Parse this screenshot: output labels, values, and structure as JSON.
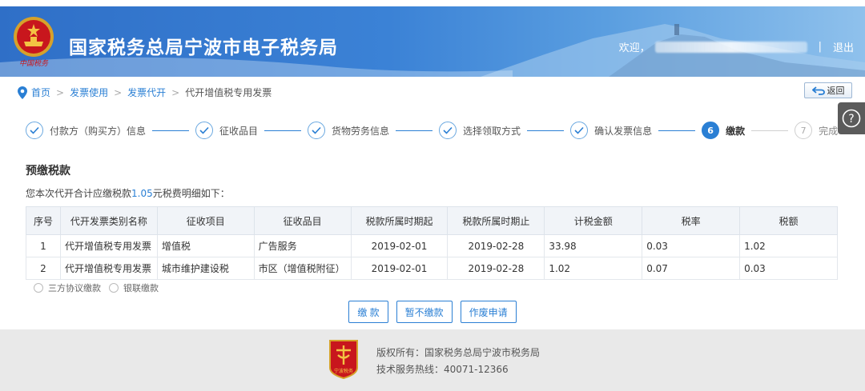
{
  "header": {
    "emblem_caption": "中国税务",
    "title": "国家税务总局宁波市电子税务局",
    "welcome": "欢迎，",
    "separator": "|",
    "logout": "退出"
  },
  "breadcrumb": {
    "items": [
      "首页",
      "发票使用",
      "发票代开",
      "代开增值税专用发票"
    ],
    "arrow": ">"
  },
  "back_label": "返回",
  "help_label": "?",
  "steps": [
    {
      "num": "1",
      "label": "付款方（购买方）信息",
      "state": "done"
    },
    {
      "num": "2",
      "label": "征收品目",
      "state": "done"
    },
    {
      "num": "3",
      "label": "货物劳务信息",
      "state": "done"
    },
    {
      "num": "4",
      "label": "选择领取方式",
      "state": "done"
    },
    {
      "num": "5",
      "label": "确认发票信息",
      "state": "done"
    },
    {
      "num": "6",
      "label": "缴款",
      "state": "active"
    },
    {
      "num": "7",
      "label": "完成",
      "state": "todo"
    }
  ],
  "section": {
    "title": "预缴税款",
    "summary_pre": "您本次代开合计应缴税款",
    "summary_amount": "1.05",
    "summary_post": "元税费明细如下："
  },
  "table": {
    "headers": [
      "序号",
      "代开发票类别名称",
      "征收项目",
      "征收品目",
      "税款所属时期起",
      "税款所属时期止",
      "计税金额",
      "税率",
      "税额"
    ],
    "rows": [
      [
        "1",
        "代开增值税专用发票",
        "增值税",
        "广告服务",
        "2019-02-01",
        "2019-02-28",
        "33.98",
        "0.03",
        "1.02"
      ],
      [
        "2",
        "代开增值税专用发票",
        "城市维护建设税",
        "市区（增值税附征）",
        "2019-02-01",
        "2019-02-28",
        "1.02",
        "0.07",
        "0.03"
      ]
    ]
  },
  "pay_options": [
    "三方协议缴款",
    "银联缴款"
  ],
  "actions": {
    "pay": "缴 款",
    "defer": "暂不缴款",
    "void": "作废申请"
  },
  "footer": {
    "copyright": "版权所有：国家税务总局宁波市税务局",
    "hotline": "技术服务热线：40071-12366",
    "logo_caption": "宁波税务"
  },
  "colors": {
    "accent": "#2a7fd4",
    "header_start": "#2f6fc7",
    "emblem_red": "#c8161d"
  }
}
